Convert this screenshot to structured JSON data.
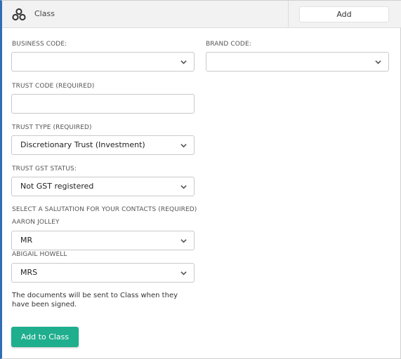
{
  "header": {
    "title": "Class",
    "add_label": "Add"
  },
  "form": {
    "business_code": {
      "label": "BUSINESS CODE:",
      "value": ""
    },
    "brand_code": {
      "label": "BRAND CODE:",
      "value": ""
    },
    "trust_code": {
      "label": "TRUST CODE (REQUIRED)",
      "value": ""
    },
    "trust_type": {
      "label": "TRUST TYPE (REQUIRED)",
      "value": "Discretionary Trust (Investment)"
    },
    "trust_gst_status": {
      "label": "TRUST GST STATUS:",
      "value": "Not GST registered"
    },
    "salutation_heading": "SELECT A SALUTATION FOR YOUR CONTACTS (REQUIRED)",
    "contacts": [
      {
        "name": "AARON JOLLEY",
        "salutation": "MR"
      },
      {
        "name": "ABIGAIL HOWELL",
        "salutation": "MRS"
      }
    ],
    "note": "The documents will be sent to Class when they have been signed.",
    "submit_label": "Add to Class"
  },
  "colors": {
    "accent_border": "#2f6db5",
    "primary_button": "#1fae8e"
  },
  "icons": {
    "logo": "class-logo-icon",
    "dropdown": "chevron-down-icon"
  }
}
